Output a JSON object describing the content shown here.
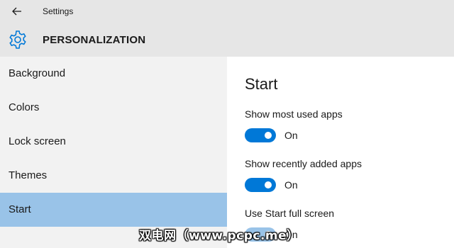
{
  "window": {
    "title": "Settings"
  },
  "header": {
    "title": "PERSONALIZATION"
  },
  "sidebar": {
    "items": [
      {
        "label": "Background",
        "selected": false
      },
      {
        "label": "Colors",
        "selected": false
      },
      {
        "label": "Lock screen",
        "selected": false
      },
      {
        "label": "Themes",
        "selected": false
      },
      {
        "label": "Start",
        "selected": true
      }
    ]
  },
  "main": {
    "title": "Start",
    "settings": [
      {
        "label": "Show most used apps",
        "state": "On"
      },
      {
        "label": "Show recently added apps",
        "state": "On"
      },
      {
        "label": "Use Start full screen",
        "state": "On"
      }
    ]
  },
  "watermark": "双电网（www.pcpc.me）",
  "colors": {
    "accent": "#0078d7",
    "selected_nav": "#99c3e8",
    "header_bg": "#e6e6e6",
    "sidebar_bg": "#f2f2f2"
  },
  "icons": {
    "back": "back-arrow-icon",
    "settings": "gear-icon"
  }
}
